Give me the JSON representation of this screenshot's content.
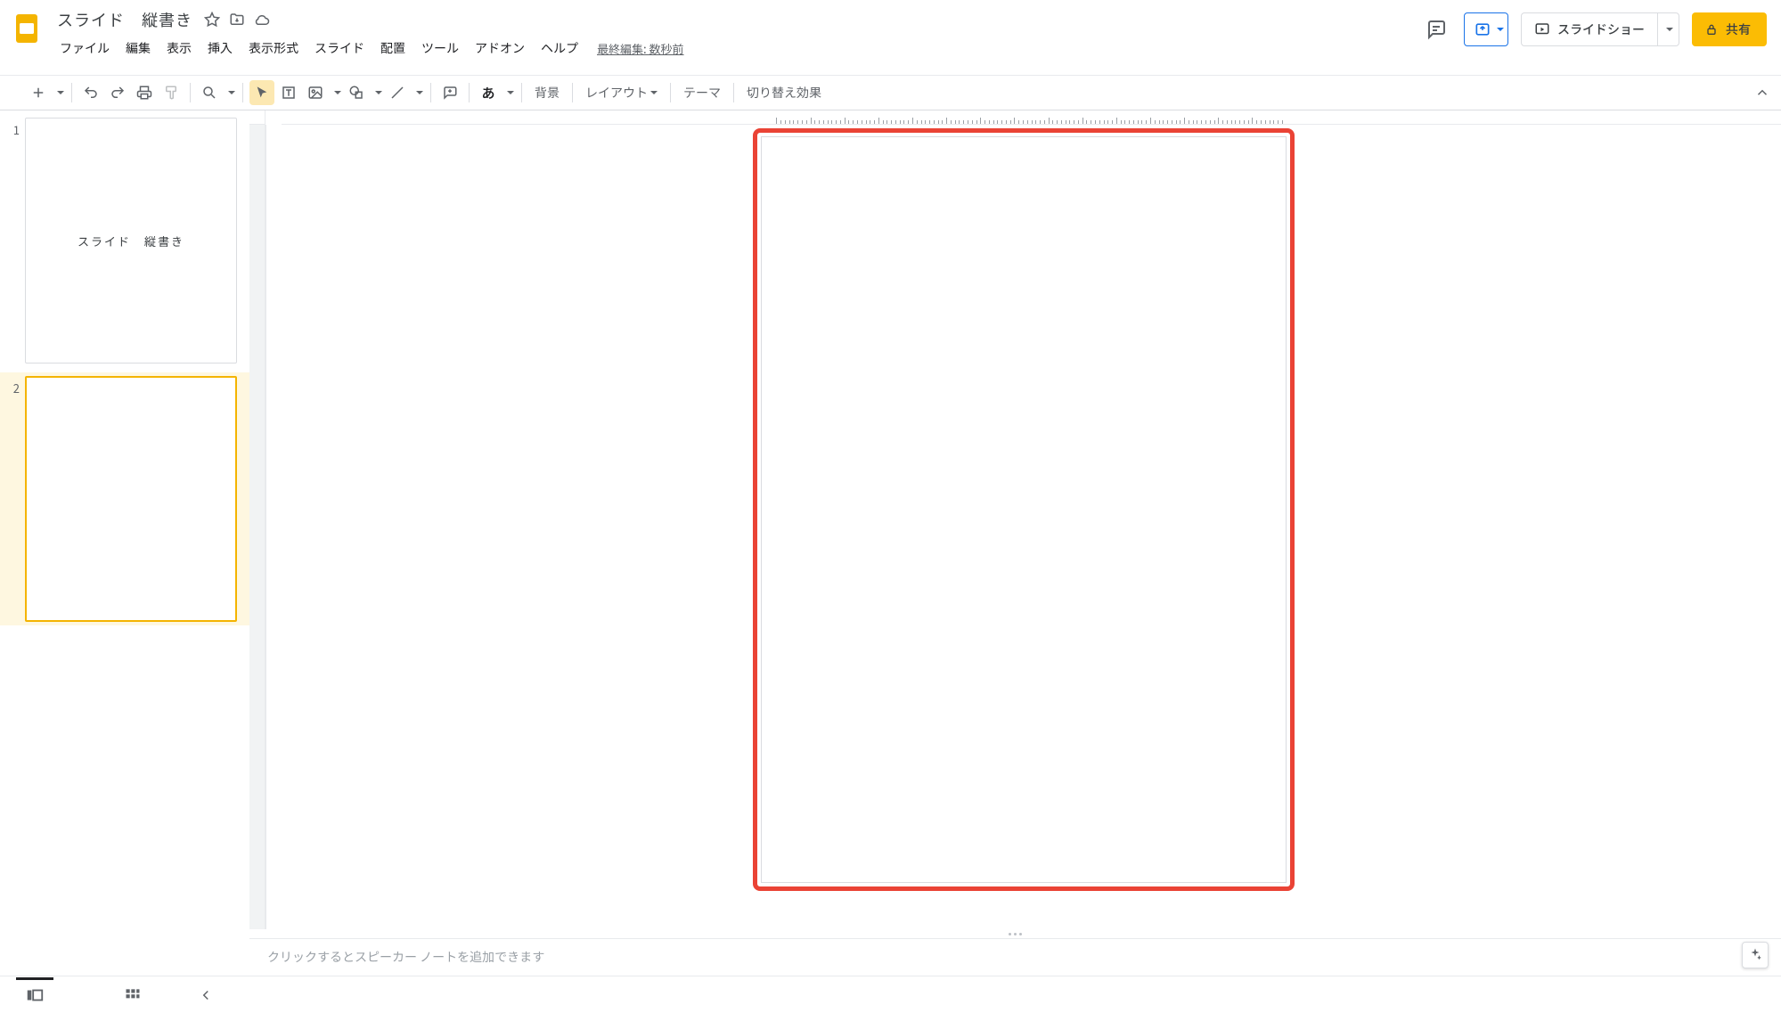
{
  "doc": {
    "title": "スライド　縦書き"
  },
  "menus": {
    "file": "ファイル",
    "edit": "編集",
    "view": "表示",
    "insert": "挿入",
    "format": "表示形式",
    "slide": "スライド",
    "arrange": "配置",
    "tools": "ツール",
    "addons": "アドオン",
    "help": "ヘルプ",
    "last_edit": "最終編集: 数秒前"
  },
  "toolbar": {
    "bg": "背景",
    "layout": "レイアウト",
    "theme": "テーマ",
    "transition": "切り替え効果",
    "ime": "あ"
  },
  "right": {
    "slideshow": "スライドショー",
    "share": "共有"
  },
  "thumbs": [
    {
      "num": "1",
      "text": "スライド　縦書き"
    },
    {
      "num": "2",
      "text": ""
    }
  ],
  "notes": {
    "placeholder": "クリックするとスピーカー ノートを追加できます"
  }
}
